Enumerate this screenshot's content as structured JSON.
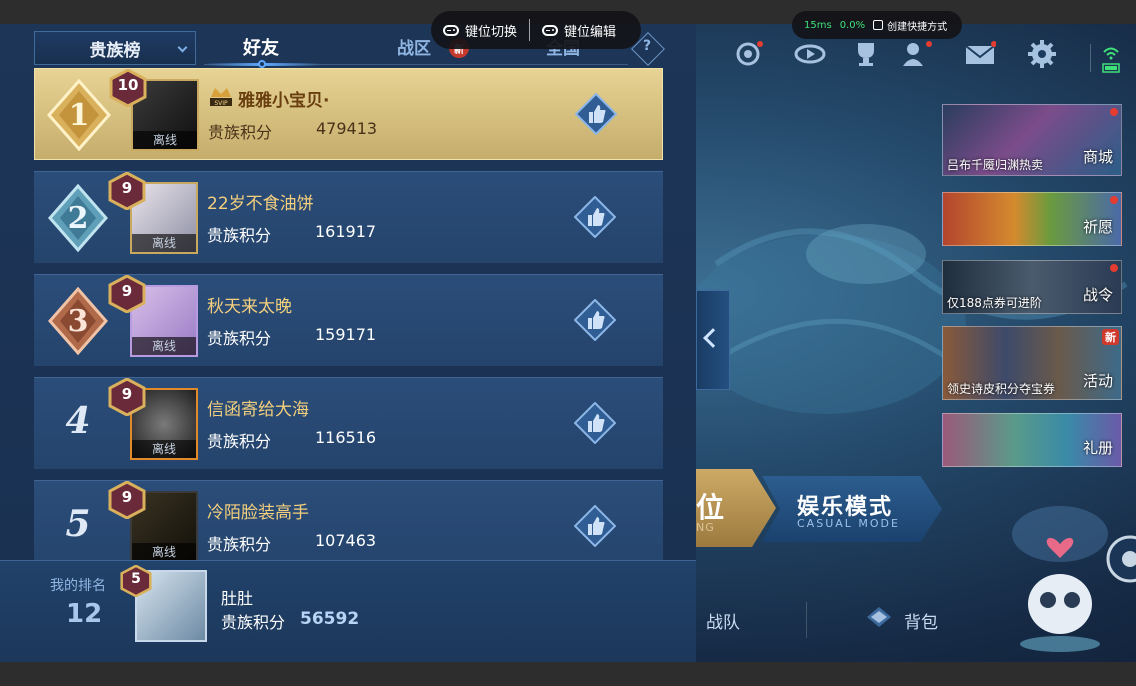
{
  "keymap": {
    "switch_label": "键位切换",
    "edit_label": "键位编辑"
  },
  "perf": {
    "ping": "15ms",
    "loss": "0.0%",
    "shortcut_label": "创建快捷方式"
  },
  "leaderboard": {
    "category": "贵族榜",
    "tabs": {
      "friends": "好友",
      "region": "战区",
      "national": "全国",
      "new_badge": "新"
    },
    "help": "?",
    "offline_label": "离线",
    "score_label": "贵族积分",
    "rows": [
      {
        "rank": "1",
        "level": "10",
        "name": "雅雅小宝贝·",
        "score": "479413",
        "svip": "SVIP"
      },
      {
        "rank": "2",
        "level": "9",
        "name": "22岁不食油饼",
        "score": "161917"
      },
      {
        "rank": "3",
        "level": "9",
        "name": "秋天来太晚",
        "score": "159171"
      },
      {
        "rank": "4",
        "level": "9",
        "name": "信函寄给大海",
        "score": "116516"
      },
      {
        "rank": "5",
        "level": "9",
        "name": "冷陌脸装高手",
        "score": "107463"
      }
    ],
    "me": {
      "label": "我的排名",
      "rank": "12",
      "level": "5",
      "name": "肚肚",
      "score_label": "贵族积分",
      "score": "56592"
    }
  },
  "lobby": {
    "promos": [
      {
        "caption": "吕布千魇归渊热卖",
        "side": "商城"
      },
      {
        "caption": "",
        "side": "祈愿"
      },
      {
        "caption": "仅188点券可进阶",
        "side": "战令"
      },
      {
        "caption": "领史诗皮积分夺宝券",
        "side": "活动",
        "tag": "新"
      },
      {
        "caption": "",
        "side": "礼册"
      }
    ],
    "mode_partial": {
      "title": "位",
      "sub": "NG"
    },
    "casual_mode": {
      "title": "娱乐模式",
      "sub": "CASUAL MODE"
    },
    "nav": {
      "team": "战队",
      "bag": "背包"
    }
  },
  "colors": {
    "gold": "#f4cf7c",
    "panel": "#1d3557",
    "accent": "#5ea9ff",
    "red": "#e53c32"
  }
}
